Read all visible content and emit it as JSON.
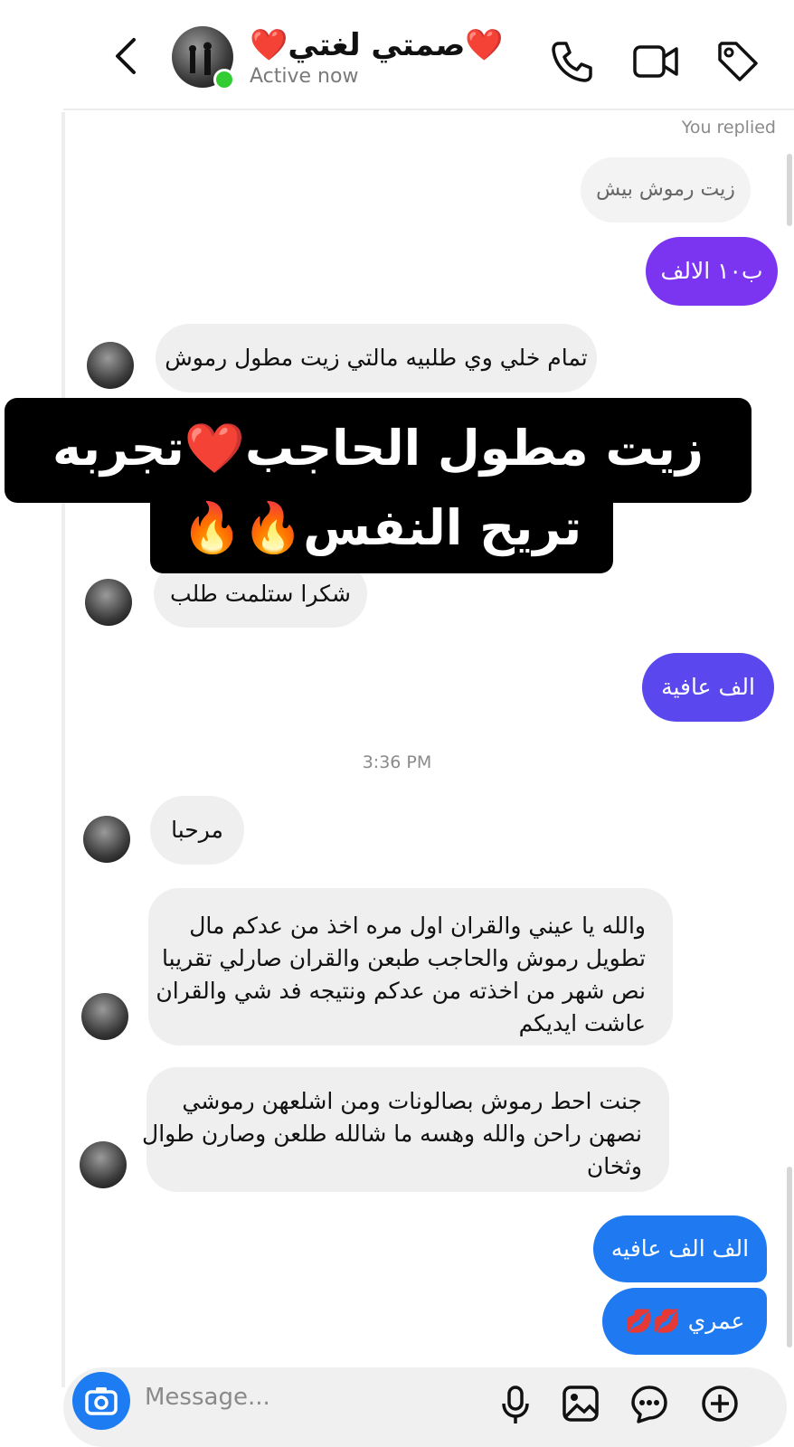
{
  "header": {
    "title": "❤️صمتي لغتي❤️",
    "status": "Active now",
    "icons": [
      "back-chevron-icon",
      "phone-icon",
      "video-camera-icon",
      "tag-icon"
    ]
  },
  "chat": {
    "replied_label": "You replied",
    "reply_quote": "زيت رموش بيش",
    "msg_price": "ب١٠ الالف",
    "msg_order": "تمام خلي وي طلبيه مالتي زيت مطول رموش",
    "msg_received": "شكرا ستلمت طلب",
    "msg_welcome_1": "الف عافية",
    "timestamp": "3:36 PM",
    "msg_hello": "مرحبا",
    "msg_review_lines": [
      "والله يا عيني والقران اول مره اخذ من عدكم مال",
      "تطويل رموش والحاجب طبعن والقران صارلي تقريبا",
      "نص شهر من اخذته من عدكم ونتيجه فد شي والقران",
      "عاشت ايديكم"
    ],
    "msg_salon_lines": [
      "جنت احط رموش بصالونات ومن اشلعهن رموشي",
      "نصهن راحن والله وهسه ما شالله طلعن وصارن طوال",
      "وثخان"
    ],
    "msg_welcome_2": "الف الف عافيه",
    "msg_kisses": "عمري 💋💋"
  },
  "overlay": {
    "line1": "زيت مطول الحاجب❤️تجربه",
    "line2": "تريح النفس🔥🔥"
  },
  "composer": {
    "placeholder": "Message...",
    "icons": [
      "camera-icon",
      "microphone-icon",
      "gallery-icon",
      "sticker-icon",
      "plus-icon"
    ]
  },
  "colors": {
    "out_purple": "#7b35f0",
    "out_indigo": "#5a48ee",
    "out_blue": "#1f7af2",
    "online": "#33cc33",
    "camera": "#1e7cf2"
  }
}
